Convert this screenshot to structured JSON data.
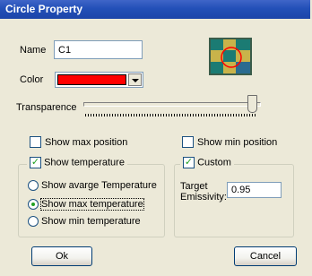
{
  "window": {
    "title": "Circle Property"
  },
  "form": {
    "name_label": "Name",
    "name_value": "C1",
    "color_label": "Color",
    "color_value": "#ff0000",
    "transparence_label": "Transparence",
    "transparence_level": 0.96
  },
  "options": {
    "show_max_position": {
      "label": "Show max position",
      "checked": false
    },
    "show_min_position": {
      "label": "Show min position",
      "checked": false
    }
  },
  "temperature_group": {
    "label": "Show temperature",
    "checked": true,
    "radios": [
      {
        "label": "Show avarge Temperature",
        "selected": false
      },
      {
        "label": "Show max temperature",
        "selected": true
      },
      {
        "label": "Show min temperature",
        "selected": false
      }
    ]
  },
  "custom_group": {
    "label": "Custom",
    "checked": true,
    "emissivity_label_1": "Target",
    "emissivity_label_2": "Emissivity:",
    "emissivity_value": "0.95"
  },
  "buttons": {
    "ok": "Ok",
    "cancel": "Cancel"
  },
  "preview": {
    "icon": "circle-preview-icon",
    "circle_color": "#ff0000"
  }
}
